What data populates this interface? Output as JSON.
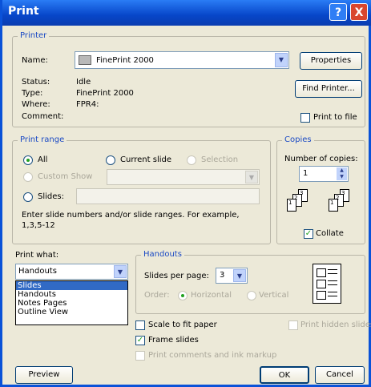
{
  "window": {
    "title": "Print",
    "help": "?",
    "close": "X"
  },
  "printer": {
    "group_label": "Printer",
    "name_label": "Name:",
    "name_value": "FinePrint 2000",
    "properties_button": "Properties",
    "find_printer_button": "Find Printer...",
    "status_label": "Status:",
    "status_value": "Idle",
    "type_label": "Type:",
    "type_value": "FinePrint 2000",
    "where_label": "Where:",
    "where_value": "FPR4:",
    "comment_label": "Comment:",
    "print_to_file": "Print to file"
  },
  "print_range": {
    "group_label": "Print range",
    "all": "All",
    "current_slide": "Current slide",
    "selection": "Selection",
    "custom_show": "Custom Show",
    "slides": "Slides:",
    "hint": "Enter slide numbers and/or slide ranges. For example, 1,3,5-12"
  },
  "copies": {
    "group_label": "Copies",
    "number_label": "Number of copies:",
    "number_value": "1",
    "collate": "Collate"
  },
  "print_what": {
    "label": "Print what:",
    "value": "Handouts",
    "options": [
      "Slides",
      "Handouts",
      "Notes Pages",
      "Outline View"
    ]
  },
  "handouts": {
    "group_label": "Handouts",
    "slides_per_page_label": "Slides per page:",
    "slides_per_page_value": "3",
    "order_label": "Order:",
    "horizontal": "Horizontal",
    "vertical": "Vertical"
  },
  "options": {
    "scale_to_fit": "Scale to fit paper",
    "frame_slides": "Frame slides",
    "print_comments": "Print comments and ink markup",
    "print_hidden": "Print hidden slides"
  },
  "buttons": {
    "preview": "Preview",
    "ok": "OK",
    "cancel": "Cancel"
  },
  "icons": {
    "printer": "printer-icon",
    "dropdown": "chevron-down-icon",
    "spinner": "spinner-icon",
    "collate": "collate-pages-icon",
    "handout_layout": "handout-layout-icon"
  }
}
